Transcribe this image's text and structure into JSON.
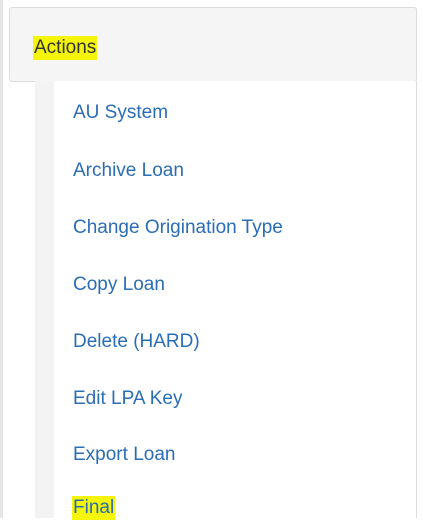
{
  "actions_panel": {
    "title": "Actions",
    "items": [
      {
        "label": "AU System"
      },
      {
        "label": "Archive Loan"
      },
      {
        "label": "Change Origination Type"
      },
      {
        "label": "Copy Loan"
      },
      {
        "label": "Delete (HARD)"
      },
      {
        "label": "Edit LPA Key"
      },
      {
        "label": "Export Loan"
      },
      {
        "label": "Final"
      }
    ]
  },
  "colors": {
    "link": "#2a6db7",
    "highlight": "#f5f50a",
    "header_bg": "#f5f5f5",
    "rail_bg": "#f3f3f3"
  }
}
